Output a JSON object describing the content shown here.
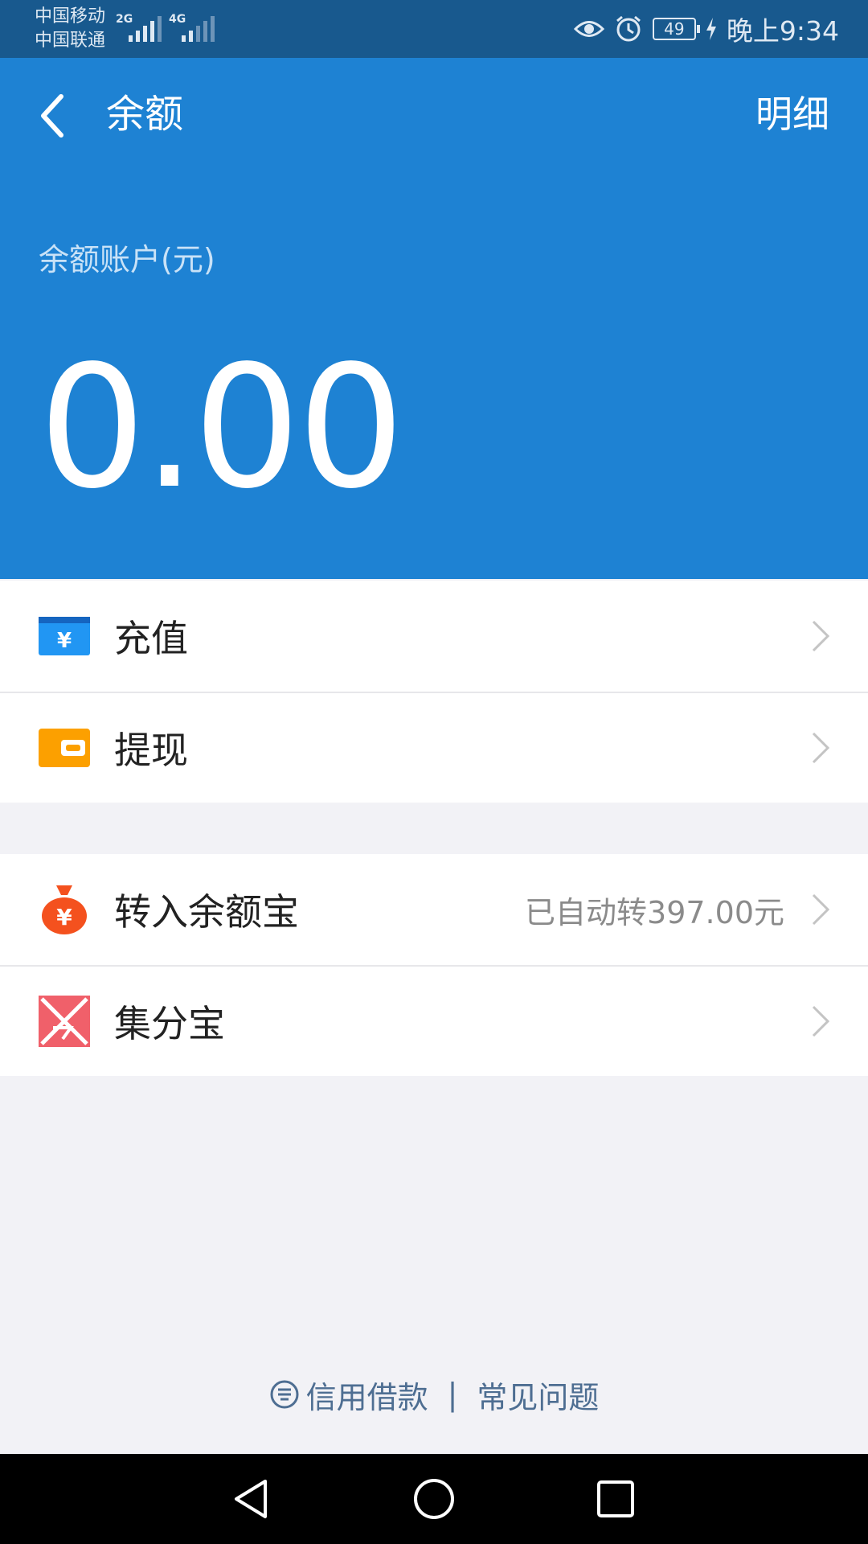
{
  "status_bar": {
    "carrier1": "中国移动",
    "carrier2": "中国联通",
    "net1": "2G",
    "net2": "4G",
    "battery": "49",
    "time": "晚上9:34"
  },
  "header": {
    "title": "余额",
    "detail_label": "明细",
    "account_label": "余额账户(元)",
    "balance": "0.00",
    "bg_color": "#1e82d3"
  },
  "menu": {
    "recharge": {
      "label": "充值",
      "icon": "recharge-card-icon"
    },
    "withdraw": {
      "label": "提现",
      "icon": "wallet-icon"
    },
    "yuebao": {
      "label": "转入余额宝",
      "value": "已自动转397.00元",
      "icon": "money-bag-icon"
    },
    "jifenbao": {
      "label": "集分宝",
      "icon": "jifenbao-icon"
    }
  },
  "footer": {
    "credit_loan": "信用借款",
    "separator": "|",
    "faq": "常见问题"
  }
}
